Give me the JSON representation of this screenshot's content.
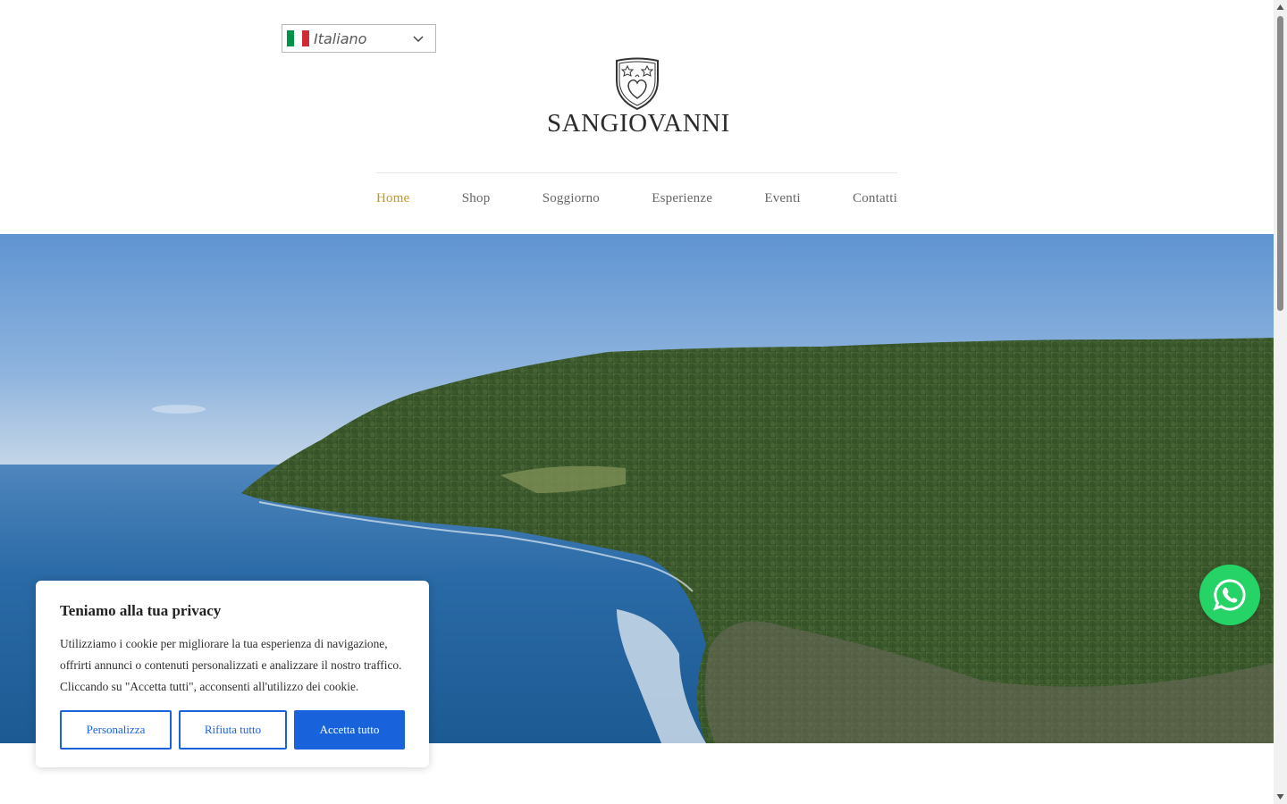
{
  "language": {
    "label": "Italiano",
    "flag_colors": [
      "#009246",
      "#ffffff",
      "#ce2b37"
    ]
  },
  "logo": {
    "text": "SANGIOVANNI"
  },
  "nav": {
    "items": [
      {
        "label": "Home",
        "active": true
      },
      {
        "label": "Shop"
      },
      {
        "label": "Soggiorno"
      },
      {
        "label": "Esperienze"
      },
      {
        "label": "Eventi"
      },
      {
        "label": "Contatti"
      }
    ],
    "accent_color": "#c9961c"
  },
  "cookie": {
    "title": "Teniamo alla tua privacy",
    "text": "Utilizziamo i cookie per migliorare la tua esperienza di navigazione, offrirti annunci o contenuti personalizzati e analizzare il nostro traffico. Cliccando su \"Accetta tutti\", acconsenti all'utilizzo dei cookie.",
    "buttons": {
      "customize": "Personalizza",
      "reject": "Rifiuta tutto",
      "accept": "Accetta tutto"
    },
    "button_color": "#1863dc"
  },
  "whatsapp": {
    "icon": "whatsapp-icon",
    "color": "#25d366"
  }
}
